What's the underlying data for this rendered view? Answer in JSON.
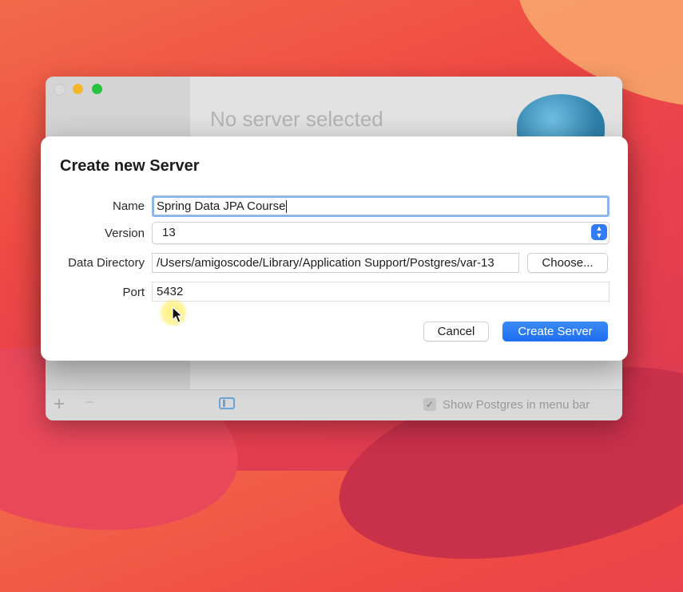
{
  "app_window": {
    "placeholder_title": "No server selected",
    "bottom_bar": {
      "add_icon": "plus-icon",
      "remove_icon": "minus-icon",
      "sidebar_toggle_icon": "sidebar-icon",
      "menubar_checkbox_checked": true,
      "menubar_label": "Show Postgres in menu bar"
    }
  },
  "dialog": {
    "title": "Create new Server",
    "fields": {
      "name_label": "Name",
      "name_value": "Spring Data JPA Course",
      "version_label": "Version",
      "version_value": "13",
      "data_directory_label": "Data Directory",
      "data_directory_value": "/Users/amigoscode/Library/Application Support/Postgres/var-13",
      "choose_label": "Choose...",
      "port_label": "Port",
      "port_value": "5432"
    },
    "buttons": {
      "cancel_label": "Cancel",
      "create_label": "Create Server"
    }
  },
  "colors": {
    "accent": "#1f6ef0",
    "focus_ring": "#8cb6ea",
    "traffic_min": "#f5b62b",
    "traffic_max": "#27c23f"
  }
}
